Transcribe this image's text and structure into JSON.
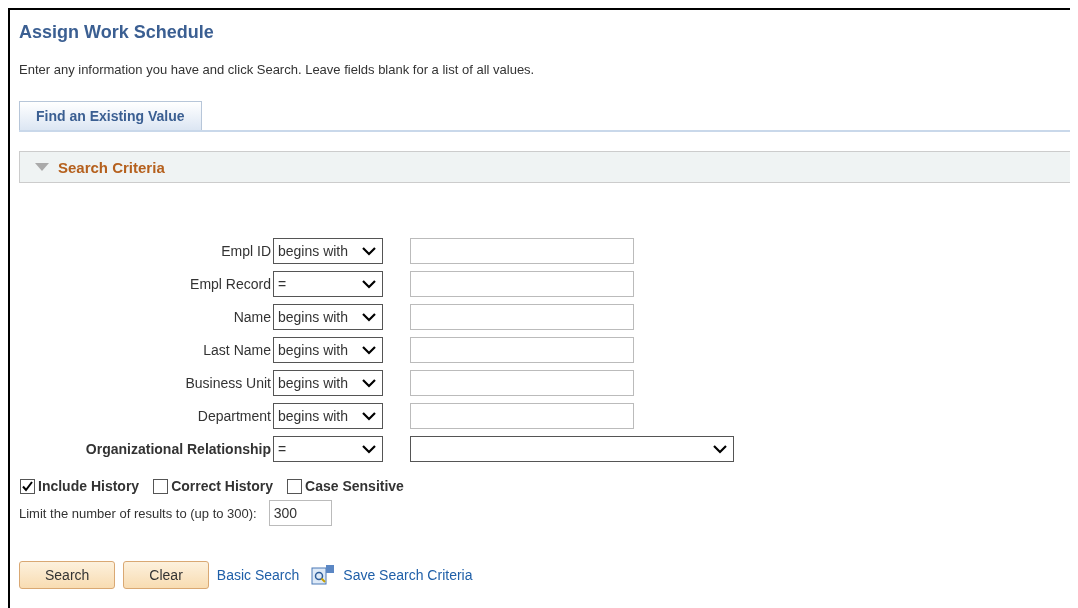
{
  "page": {
    "title": "Assign Work Schedule",
    "instructions": "Enter any information you have and click Search. Leave fields blank for a list of all values."
  },
  "tabs": [
    {
      "label": "Find an Existing Value",
      "selected": true
    }
  ],
  "section": {
    "title": "Search Criteria",
    "expanded": true
  },
  "criteria": [
    {
      "label": "Empl ID",
      "bold": false,
      "operator": "begins with",
      "kind": "text"
    },
    {
      "label": "Empl Record",
      "bold": false,
      "operator": "=",
      "kind": "text"
    },
    {
      "label": "Name",
      "bold": false,
      "operator": "begins with",
      "kind": "text"
    },
    {
      "label": "Last Name",
      "bold": false,
      "operator": "begins with",
      "kind": "text"
    },
    {
      "label": "Business Unit",
      "bold": false,
      "operator": "begins with",
      "kind": "text"
    },
    {
      "label": "Department",
      "bold": false,
      "operator": "begins with",
      "kind": "text"
    },
    {
      "label": "Organizational Relationship",
      "bold": true,
      "operator": "=",
      "kind": "select"
    }
  ],
  "options": [
    {
      "label": "Include History",
      "checked": true
    },
    {
      "label": "Correct History",
      "checked": false
    },
    {
      "label": "Case Sensitive",
      "checked": false
    }
  ],
  "limit": {
    "label": "Limit the number of results to (up to 300):",
    "value": "300"
  },
  "buttons": [
    "Search",
    "Clear"
  ],
  "links": [
    "Basic Search",
    "Save Search Criteria"
  ]
}
